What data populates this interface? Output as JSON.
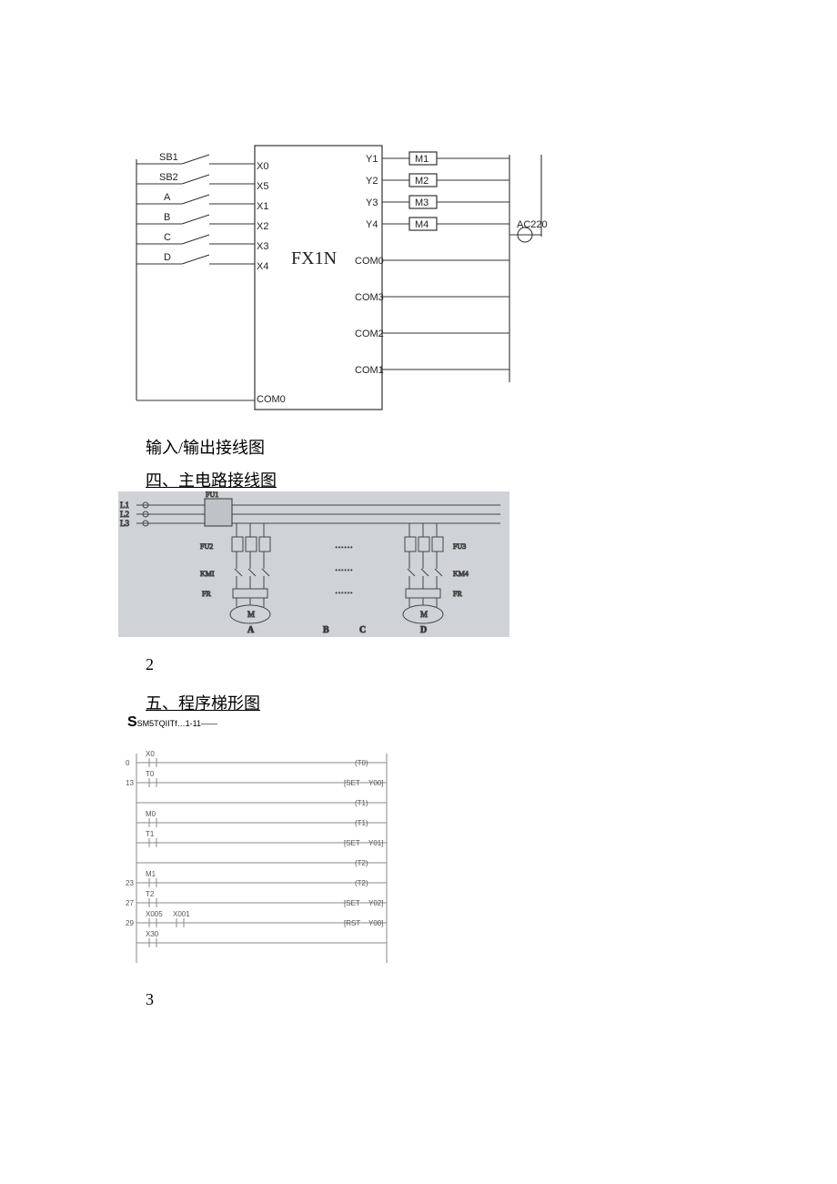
{
  "plc": {
    "model": "FX1N",
    "inputs": [
      "SB1",
      "SB2",
      "A",
      "B",
      "C",
      "D"
    ],
    "input_terms": [
      "X0",
      "X5",
      "X1",
      "X2",
      "X3",
      "X4"
    ],
    "com_in": "COM0",
    "output_terms": [
      "Y1",
      "Y2",
      "Y3",
      "Y4"
    ],
    "output_coms": [
      "COM0",
      "COM3",
      "COM2",
      "COM1"
    ],
    "loads": [
      "M1",
      "M2",
      "M3",
      "M4"
    ],
    "supply": "AC220"
  },
  "caption1": "输入/输出接线图",
  "heading4": "四、主电路接线图",
  "page2": "2",
  "heading5": "五、程序梯形图",
  "subhead": "SM5TQIITf…1-11——",
  "page3": "3",
  "main_circuit": {
    "lines": [
      "L1",
      "L2",
      "L3"
    ],
    "fuse1": "FU1",
    "fuse2": "FU2",
    "fuse3": "FU3",
    "km": "KMI",
    "km4": "KM4",
    "fr": "FR",
    "motor": "M",
    "labels": [
      "A",
      "B",
      "C",
      "D"
    ]
  },
  "ladder": {
    "rungs": [
      {
        "addr": "0",
        "left": "X0",
        "right": "T0",
        "right2": ""
      },
      {
        "addr": "13",
        "left": "T0",
        "right": "SET",
        "right2": "Y00"
      },
      {
        "addr": "",
        "left": "",
        "right": "T1",
        "right2": ""
      },
      {
        "addr": "",
        "left": "M0",
        "right": "T1",
        "right2": ""
      },
      {
        "addr": "",
        "left": "T1",
        "right": "SET",
        "right2": "Y01"
      },
      {
        "addr": "",
        "left": "",
        "right": "T2",
        "right2": ""
      },
      {
        "addr": "23",
        "left": "M1",
        "right": "T2",
        "right2": ""
      },
      {
        "addr": "27",
        "left": "T2",
        "right": "SET",
        "right2": "Y02"
      },
      {
        "addr": "29",
        "left": "X005",
        "left2": "X001",
        "right": "RST",
        "right2": "Y00"
      },
      {
        "addr": "",
        "left": "X30",
        "right": "",
        "right2": ""
      }
    ]
  }
}
